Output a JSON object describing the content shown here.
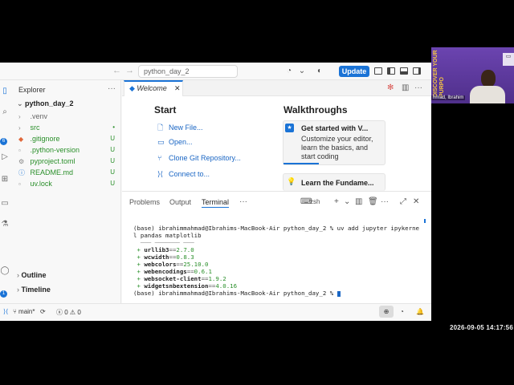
{
  "titlebar": {
    "search_text": "python_day_2",
    "update_label": "Update"
  },
  "sidebar": {
    "title": "Explorer",
    "folder": "python_day_2",
    "items": [
      {
        "icon": "chevron-right-icon",
        "label": ".venv",
        "status": ""
      },
      {
        "icon": "chevron-right-icon",
        "label": "src",
        "status": "•"
      },
      {
        "icon": "git-icon",
        "label": ".gitignore",
        "status": "U"
      },
      {
        "icon": "file-icon",
        "label": ".python-version",
        "status": "U"
      },
      {
        "icon": "gear-icon",
        "label": "pyproject.toml",
        "status": "U"
      },
      {
        "icon": "info-icon",
        "label": "README.md",
        "status": "U"
      },
      {
        "icon": "file-icon",
        "label": "uv.lock",
        "status": "U"
      }
    ],
    "outline_label": "Outline",
    "timeline_label": "Timeline"
  },
  "editor": {
    "tab_label": "Welcome",
    "start": {
      "title": "Start",
      "items": [
        {
          "icon": "new-file-icon",
          "label": "New File..."
        },
        {
          "icon": "folder-open-icon",
          "label": "Open..."
        },
        {
          "icon": "git-clone-icon",
          "label": "Clone Git Repository..."
        },
        {
          "icon": "remote-icon",
          "label": "Connect to..."
        }
      ]
    },
    "walkthroughs": {
      "title": "Walkthroughs",
      "cards": [
        {
          "title": "Get started with V...",
          "desc": "Customize your editor, learn the basics, and start coding",
          "progress": 0.35
        },
        {
          "title": "Learn the Fundame...",
          "desc": ""
        }
      ]
    }
  },
  "panel": {
    "tabs": [
      "Problems",
      "Output",
      "Terminal"
    ],
    "active_tab": "Terminal",
    "shell": "zsh",
    "terminal": {
      "command_line_1": "(base) ibrahimmahmad@Ibrahims-MacBook-Air python_day_2 % uv add jupyter ipykerne",
      "command_line_2": "l pandas matplotlib",
      "packages": [
        {
          "name": "urllib3",
          "version": "2.7.0"
        },
        {
          "name": "wcwidth",
          "version": "0.8.3"
        },
        {
          "name": "webcolors",
          "version": "25.10.0"
        },
        {
          "name": "webencodings",
          "version": "0.6.1"
        },
        {
          "name": "websocket-client",
          "version": "1.9.2"
        },
        {
          "name": "widgetsnbextension",
          "version": "4.0.16"
        }
      ],
      "prompt": "(base) ibrahimmahmad@Ibrahims-MacBook-Air python_day_2 % "
    }
  },
  "statusbar": {
    "branch": "main*",
    "errors": "0",
    "warnings": "0"
  },
  "webcam": {
    "name": "hmad, Ibrahim",
    "banner": "DISCOVER YOUR PURPO"
  },
  "timestamp": "2026-09-05 14:17:56",
  "colors": {
    "accent": "#1a73d6",
    "added": "#2a8f2a"
  }
}
